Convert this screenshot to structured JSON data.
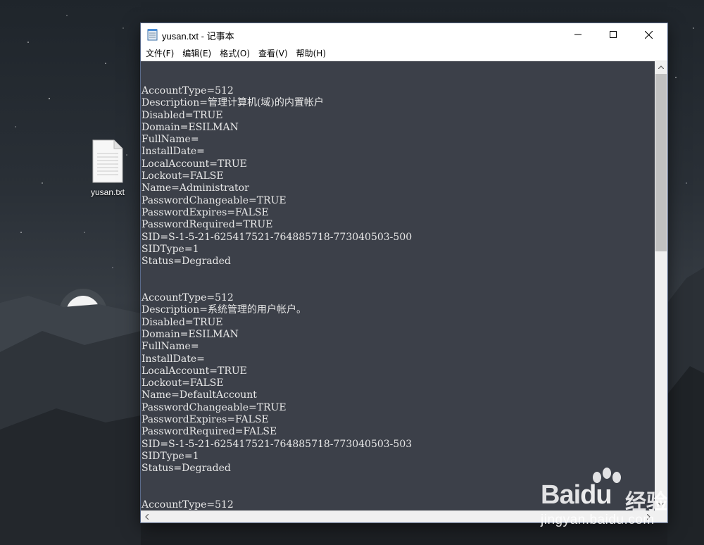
{
  "desktop": {
    "icon_label": "yusan.txt"
  },
  "window": {
    "title": "yusan.txt - 记事本",
    "controls": {
      "minimize": "minimize-icon",
      "maximize": "maximize-icon",
      "close": "close-icon"
    },
    "menu": [
      "文件(F)",
      "编辑(E)",
      "格式(O)",
      "查看(V)",
      "帮助(H)"
    ]
  },
  "editor": {
    "lines": [
      "AccountType=512",
      "Description=管理计算机(域)的内置帐户",
      "Disabled=TRUE",
      "Domain=ESILMAN",
      "FullName=",
      "InstallDate=",
      "LocalAccount=TRUE",
      "Lockout=FALSE",
      "Name=Administrator",
      "PasswordChangeable=TRUE",
      "PasswordExpires=FALSE",
      "PasswordRequired=TRUE",
      "SID=S-1-5-21-625417521-764885718-773040503-500",
      "SIDType=1",
      "Status=Degraded",
      "",
      "",
      "AccountType=512",
      "Description=系统管理的用户帐户。",
      "Disabled=TRUE",
      "Domain=ESILMAN",
      "FullName=",
      "InstallDate=",
      "LocalAccount=TRUE",
      "Lockout=FALSE",
      "Name=DefaultAccount",
      "PasswordChangeable=TRUE",
      "PasswordExpires=FALSE",
      "PasswordRequired=FALSE",
      "SID=S-1-5-21-625417521-764885718-773040503-503",
      "SIDType=1",
      "Status=Degraded",
      "",
      "",
      "AccountType=512"
    ]
  },
  "watermark": {
    "brand_bai": "Bai",
    "brand_du": "du",
    "brand_cn": "经验",
    "url": "jingyan.baidu.com"
  }
}
